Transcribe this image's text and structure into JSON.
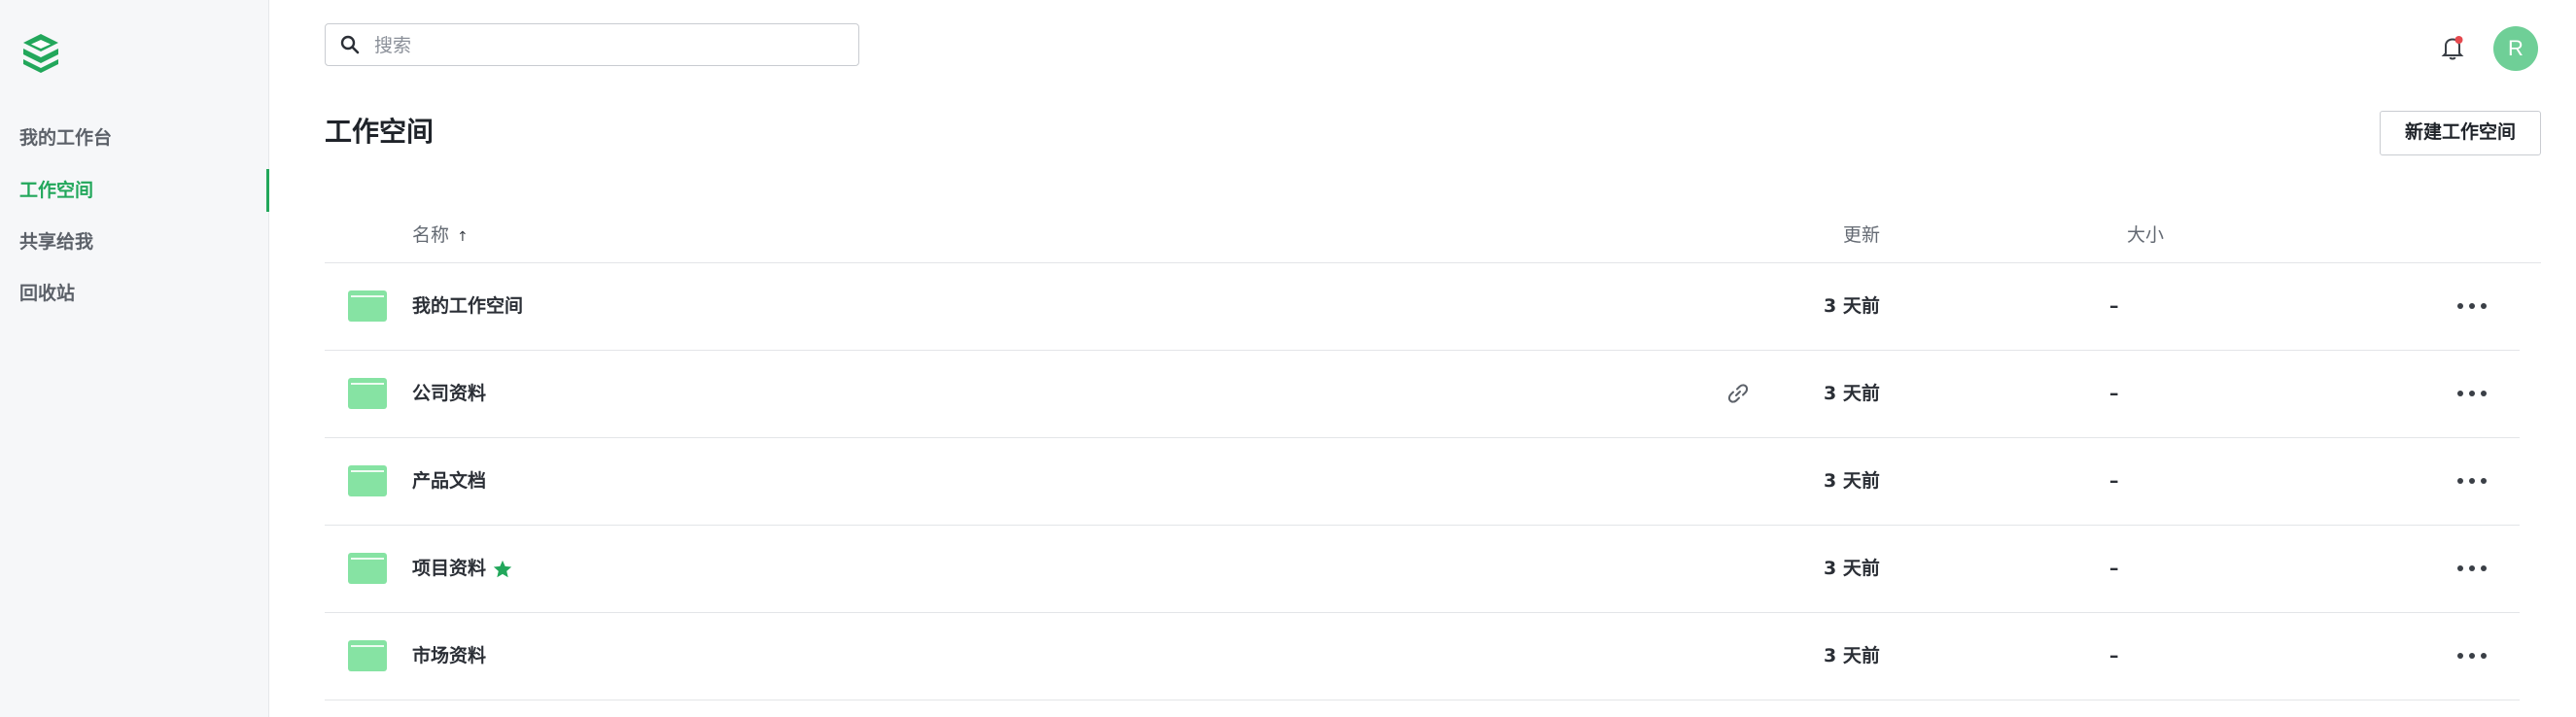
{
  "sidebar": {
    "items": [
      {
        "label": "我的工作台",
        "active": false
      },
      {
        "label": "工作空间",
        "active": true
      },
      {
        "label": "共享给我",
        "active": false
      },
      {
        "label": "回收站",
        "active": false
      }
    ]
  },
  "header": {
    "search_placeholder": "搜索",
    "avatar_initial": "R"
  },
  "main": {
    "title": "工作空间",
    "new_button_label": "新建工作空间",
    "columns": {
      "name": "名称",
      "updated": "更新",
      "size": "大小"
    },
    "rows": [
      {
        "name": "我的工作空间",
        "updated": "3 天前",
        "size": "–",
        "shared_link": false,
        "starred": false
      },
      {
        "name": "公司资料",
        "updated": "3 天前",
        "size": "–",
        "shared_link": true,
        "starred": false
      },
      {
        "name": "产品文档",
        "updated": "3 天前",
        "size": "–",
        "shared_link": false,
        "starred": false
      },
      {
        "name": "项目资料",
        "updated": "3 天前",
        "size": "–",
        "shared_link": false,
        "starred": true
      },
      {
        "name": "市场资料",
        "updated": "3 天前",
        "size": "–",
        "shared_link": false,
        "starred": false
      }
    ]
  },
  "icons": {
    "logo": "logo-icon",
    "search": "search-icon",
    "bell": "bell-icon",
    "folder": "folder-icon",
    "link": "link-icon",
    "star": "star-icon",
    "more": "more-icon",
    "sort": "sort-ascending-icon"
  },
  "colors": {
    "accent": "#22a75b",
    "folder": "#86e3a3",
    "avatar": "#6fcf97",
    "notification_dot": "#e5484d"
  }
}
